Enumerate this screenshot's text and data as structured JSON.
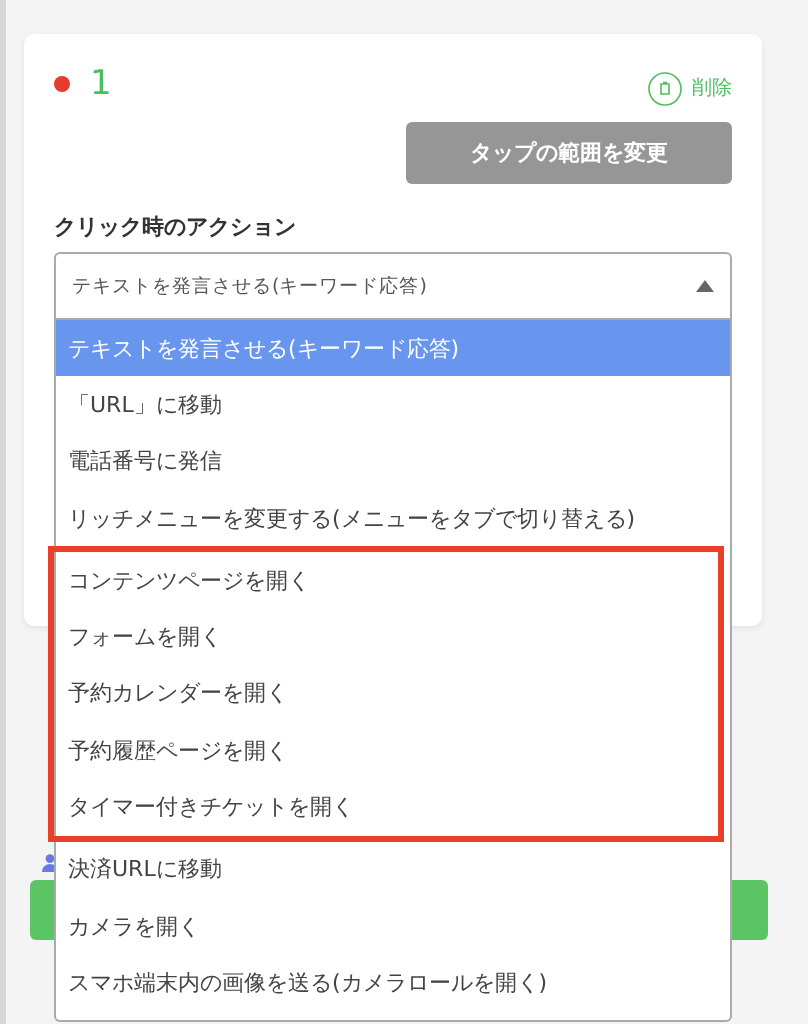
{
  "card": {
    "number": "1",
    "delete_label": "削除",
    "range_button": "タップの範囲を変更",
    "action_label": "クリック時のアクション"
  },
  "select": {
    "value": "テキストを発言させる(キーワード応答)",
    "expanded": true,
    "options": [
      {
        "label": "テキストを発言させる(キーワード応答)",
        "selected": true,
        "highlighted": false
      },
      {
        "label": "「URL」に移動",
        "selected": false,
        "highlighted": false
      },
      {
        "label": "電話番号に発信",
        "selected": false,
        "highlighted": false
      },
      {
        "label": "リッチメニューを変更する(メニューをタブで切り替える)",
        "selected": false,
        "highlighted": false
      },
      {
        "label": "コンテンツページを開く",
        "selected": false,
        "highlighted": true
      },
      {
        "label": "フォームを開く",
        "selected": false,
        "highlighted": true
      },
      {
        "label": "予約カレンダーを開く",
        "selected": false,
        "highlighted": true
      },
      {
        "label": "予約履歴ページを開く",
        "selected": false,
        "highlighted": true
      },
      {
        "label": "タイマー付きチケットを開く",
        "selected": false,
        "highlighted": true
      },
      {
        "label": "決済URLに移動",
        "selected": false,
        "highlighted": false
      },
      {
        "label": "カメラを開く",
        "selected": false,
        "highlighted": false
      },
      {
        "label": "スマホ端末内の画像を送る(カメラロールを開く)",
        "selected": false,
        "highlighted": false
      }
    ]
  }
}
